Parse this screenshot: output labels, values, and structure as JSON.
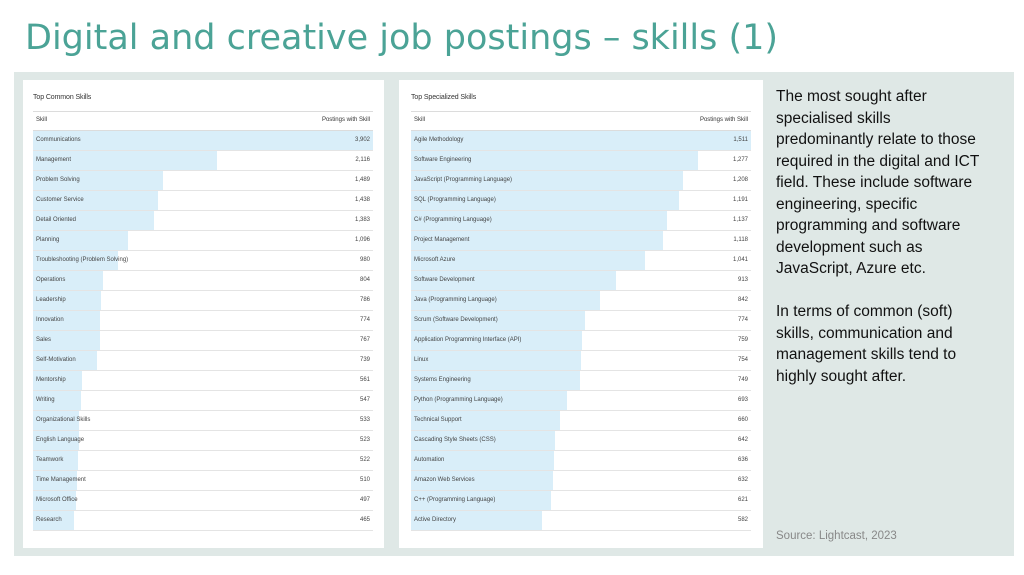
{
  "title": "Digital and creative job postings – skills (1)",
  "description": [
    "The most sought after specialised skills predominantly relate to those required in the digital and ICT field. These include software engineering, specific programming and software development such as JavaScript, Azure etc.",
    "In terms of common (soft) skills, communication and management skills tend to highly sought after."
  ],
  "source": "Source: Lightcast, 2023",
  "chart_data": [
    {
      "type": "bar",
      "title": "Top Common Skills",
      "column_headers": [
        "Skill",
        "Postings with Skill"
      ],
      "categories": [
        "Communications",
        "Management",
        "Problem Solving",
        "Customer Service",
        "Detail Oriented",
        "Planning",
        "Troubleshooting (Problem Solving)",
        "Operations",
        "Leadership",
        "Innovation",
        "Sales",
        "Self-Motivation",
        "Mentorship",
        "Writing",
        "Organizational Skills",
        "English Language",
        "Teamwork",
        "Time Management",
        "Microsoft Office",
        "Research"
      ],
      "values": [
        3902,
        2116,
        1489,
        1438,
        1383,
        1096,
        980,
        804,
        786,
        774,
        767,
        739,
        561,
        547,
        533,
        523,
        522,
        510,
        497,
        465
      ],
      "value_labels": [
        "3,902",
        "2,116",
        "1,489",
        "1,438",
        "1,383",
        "1,096",
        "980",
        "804",
        "786",
        "774",
        "767",
        "739",
        "561",
        "547",
        "533",
        "523",
        "522",
        "510",
        "497",
        "465"
      ],
      "xlim": [
        0,
        3902
      ]
    },
    {
      "type": "bar",
      "title": "Top Specialized Skills",
      "column_headers": [
        "Skill",
        "Postings with Skill"
      ],
      "categories": [
        "Agile Methodology",
        "Software Engineering",
        "JavaScript (Programming Language)",
        "SQL (Programming Language)",
        "C# (Programming Language)",
        "Project Management",
        "Microsoft Azure",
        "Software Development",
        "Java (Programming Language)",
        "Scrum (Software Development)",
        "Application Programming Interface (API)",
        "Linux",
        "Systems Engineering",
        "Python (Programming Language)",
        "Technical Support",
        "Cascading Style Sheets (CSS)",
        "Automation",
        "Amazon Web Services",
        "C++ (Programming Language)",
        "Active Directory"
      ],
      "values": [
        1511,
        1277,
        1208,
        1191,
        1137,
        1118,
        1041,
        913,
        842,
        774,
        759,
        754,
        749,
        693,
        660,
        642,
        636,
        632,
        621,
        582
      ],
      "value_labels": [
        "1,511",
        "1,277",
        "1,208",
        "1,191",
        "1,137",
        "1,118",
        "1,041",
        "913",
        "842",
        "774",
        "759",
        "754",
        "749",
        "693",
        "660",
        "642",
        "636",
        "632",
        "621",
        "582"
      ],
      "xlim": [
        0,
        1511
      ]
    }
  ]
}
